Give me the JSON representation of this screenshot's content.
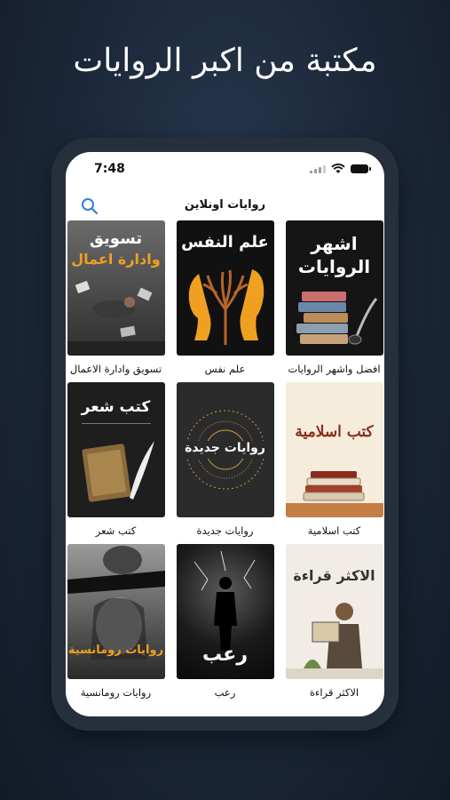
{
  "headline": "مكتبة من اكبر الروايات",
  "status_bar": {
    "time": "7:48"
  },
  "navbar": {
    "title": "روايات اونلاين"
  },
  "books": [
    {
      "title": "افضل واشهر الروايات",
      "cover_text": [
        "اشهر",
        "الروايات"
      ]
    },
    {
      "title": "علم نفس",
      "cover_text": [
        "علم النفس"
      ]
    },
    {
      "title": "تسويق وادارة الاعمال",
      "cover_text": [
        "تسويق",
        "وادارة اعمال"
      ]
    },
    {
      "title": "كتب اسلامية",
      "cover_text": [
        "كتب اسلامية"
      ]
    },
    {
      "title": "روايات جديدة",
      "cover_text": [
        "روايات جديدة"
      ]
    },
    {
      "title": "كتب شعر",
      "cover_text": [
        "كتب شعر"
      ]
    },
    {
      "title": "الاكثر قراءة",
      "cover_text": [
        "الاكثر قراءة"
      ]
    },
    {
      "title": "رعب",
      "cover_text": [
        "رعب"
      ]
    },
    {
      "title": "روايات رومانسية",
      "cover_text": [
        "روايات رومانسية"
      ]
    }
  ],
  "colors": {
    "accent": "#2f7fdb",
    "phone_frame": "#26303c",
    "background": "#1d2a3c"
  }
}
